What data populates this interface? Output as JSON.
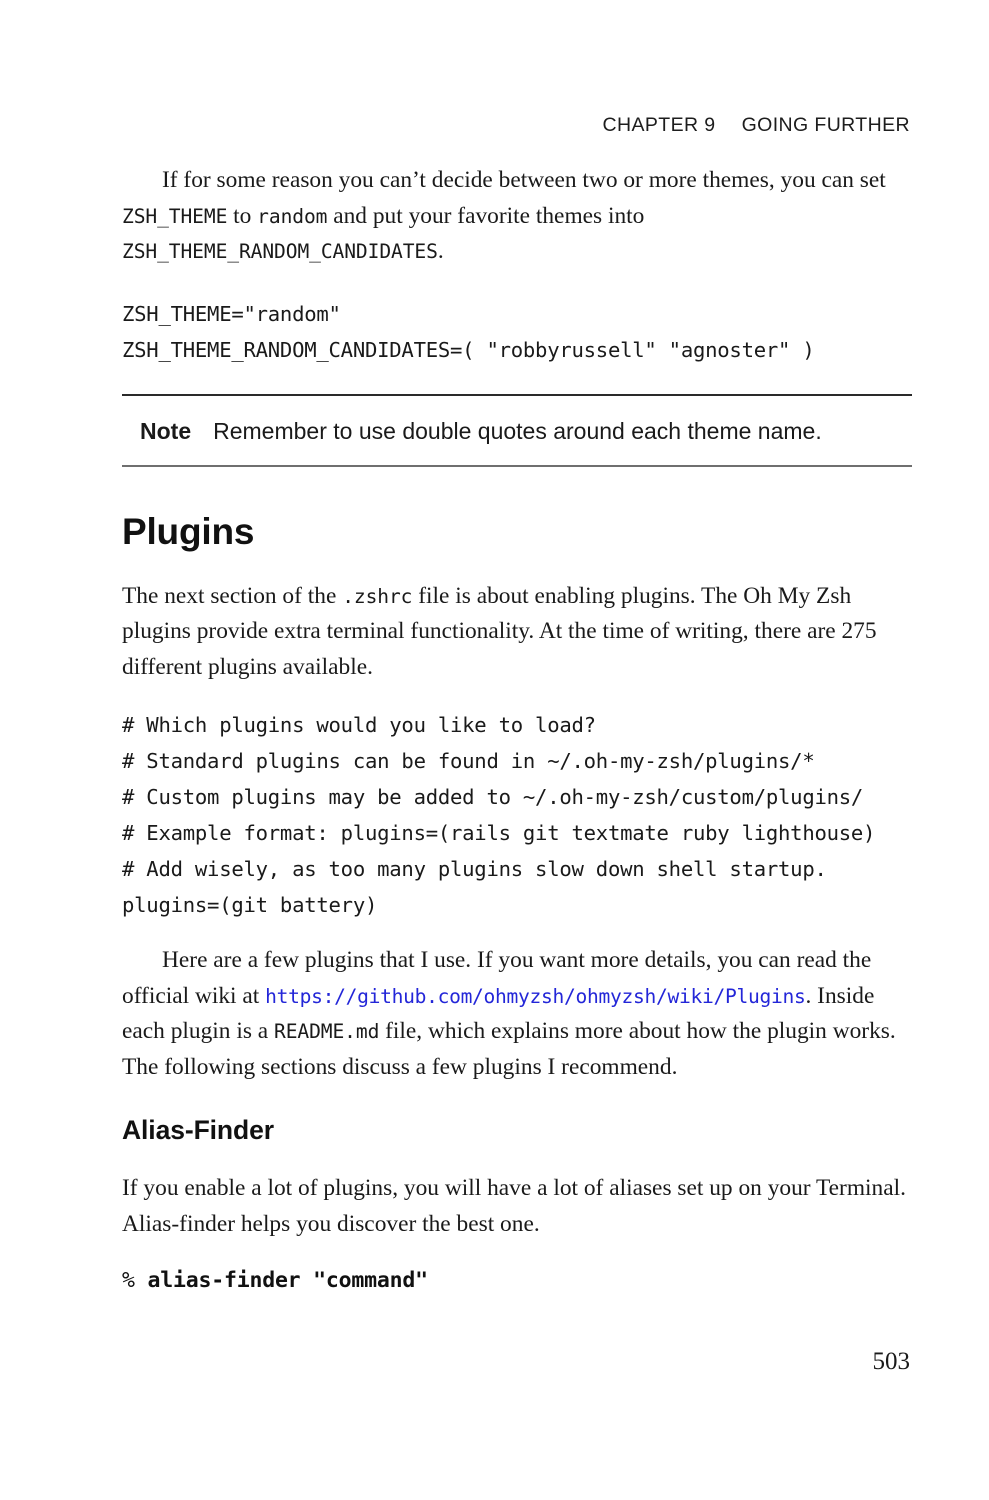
{
  "page": {
    "number": "503",
    "background_color": "#ffffff",
    "text_color": "#1a1a1a",
    "link_color": "#2326d8"
  },
  "running_head": {
    "chapter_label": "CHAPTER 9",
    "chapter_title": "GOING FURTHER"
  },
  "paragraphs": {
    "intro_1": "If for some reason you can’t decide between two or more themes, you can set ",
    "intro_code_1": "ZSH_THEME",
    "intro_2": " to ",
    "intro_code_2": "random",
    "intro_3": " and put your favorite themes into ",
    "intro_code_3": "ZSH_THEME_RANDOM_CANDIDATES",
    "intro_4": ".",
    "plugins_intro_1": "The next section of the ",
    "plugins_intro_code_1": ".zshrc",
    "plugins_intro_2": " file is about enabling plugins. The Oh My Zsh plugins provide extra terminal functionality. At the time of writing, there are 275 different plugins available.",
    "wiki_1": "Here are a few plugins that I use. If you want more details, you can read the official wiki at ",
    "wiki_link": "https://github.com/ohmyzsh/ohmyzsh/wiki/Plugins",
    "wiki_2": ". Inside each plugin is a ",
    "wiki_code": "README.md",
    "wiki_3": " file, which explains more about how the plugin works. The following sections discuss a few plugins I recommend.",
    "alias_finder_body": "If you enable a lot of plugins, you will have a lot of aliases set up on your Terminal. Alias-finder helps you discover the best one."
  },
  "code_blocks": {
    "theme_random": "ZSH_THEME=\"random\"\nZSH_THEME_RANDOM_CANDIDATES=( \"robbyrussell\" \"agnoster\" )",
    "plugins_config": "# Which plugins would you like to load?\n# Standard plugins can be found in ~/.oh-my-zsh/plugins/*\n# Custom plugins may be added to ~/.oh-my-zsh/custom/plugins/\n# Example format: plugins=(rails git textmate ruby lighthouse)\n# Add wisely, as too many plugins slow down shell startup.\nplugins=(git battery)"
  },
  "note": {
    "label": "Note",
    "text": "Remember to use double quotes around each theme name."
  },
  "headings": {
    "plugins": "Plugins",
    "alias_finder": "Alias-Finder"
  },
  "command": {
    "prompt": "% ",
    "text": "alias-finder \"command\""
  }
}
